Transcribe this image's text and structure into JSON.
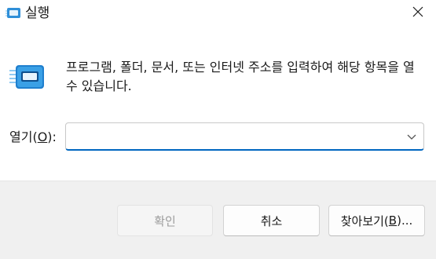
{
  "window": {
    "title": "실행",
    "icon": "run-icon"
  },
  "description": "프로그램, 폴더, 문서, 또는 인터넷 주소를 입력하여 해당 항목을 열 수 있습니다.",
  "open": {
    "label_prefix": "열기(",
    "label_mnemonic": "O",
    "label_suffix": "):",
    "value": "",
    "placeholder": ""
  },
  "buttons": {
    "ok": "확인",
    "cancel": "취소",
    "browse_prefix": "찾아보기(",
    "browse_mnemonic": "B",
    "browse_suffix": ")..."
  },
  "colors": {
    "accent": "#0067c0",
    "footer_bg": "#f0f0f0",
    "disabled_text": "#9c9c9c"
  }
}
